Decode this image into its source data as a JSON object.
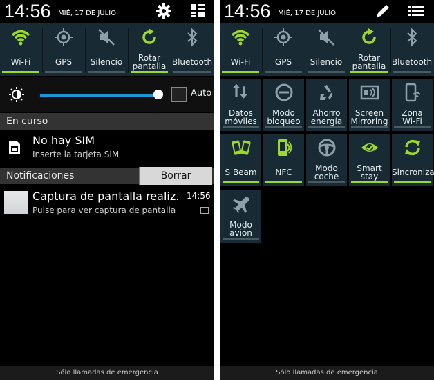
{
  "status": {
    "time": "14:56",
    "date": "MIÉ, 17 DE JULIO",
    "left_icons": [
      "gear-icon",
      "list-toggle-icon"
    ],
    "right_icons": [
      "edit-pencil-icon",
      "menu-list-icon"
    ]
  },
  "quick_settings": [
    {
      "label": "Wi-Fi",
      "icon": "wifi-icon",
      "active": true
    },
    {
      "label": "GPS",
      "icon": "gps-icon",
      "active": false
    },
    {
      "label": "Silencio",
      "icon": "mute-icon",
      "active": false
    },
    {
      "label_lines": [
        "Rotar",
        "pantalla"
      ],
      "icon": "rotate-icon",
      "active": true
    },
    {
      "label": "Bluetooth",
      "icon": "bluetooth-icon",
      "active": false
    }
  ],
  "brightness": {
    "auto_label": "Auto",
    "level": 0.95,
    "auto_checked": false
  },
  "en_curso": {
    "header": "En curso",
    "sim_title": "No hay SIM",
    "sim_text": "Inserte la tarjeta SIM"
  },
  "notificaciones": {
    "header": "Notificaciones",
    "clear_label": "Borrar",
    "item": {
      "title": "Captura de pantalla realiz..",
      "time": "14:56",
      "text": "Pulse para ver captura de pantalla"
    }
  },
  "grid_tiles": [
    {
      "label_lines": [
        "Datos",
        "móviles"
      ],
      "icon": "mobile-data-icon",
      "active": false
    },
    {
      "label_lines": [
        "Modo",
        "bloqueo"
      ],
      "icon": "block-mode-icon",
      "active": false
    },
    {
      "label_lines": [
        "Ahorro",
        "energía"
      ],
      "icon": "power-saving-icon",
      "active": false
    },
    {
      "label_lines": [
        "Screen",
        "Mirroring"
      ],
      "icon": "screen-mirroring-icon",
      "active": false
    },
    {
      "label_lines": [
        "Zona",
        "Wi-Fi"
      ],
      "icon": "hotspot-icon",
      "active": false
    },
    {
      "label": "S Beam",
      "icon": "s-beam-icon",
      "active": true
    },
    {
      "label": "NFC",
      "icon": "nfc-icon",
      "active": true
    },
    {
      "label_lines": [
        "Modo",
        "coche"
      ],
      "icon": "car-mode-icon",
      "active": false
    },
    {
      "label_lines": [
        "Smart",
        "stay"
      ],
      "icon": "smart-stay-icon",
      "active": true
    },
    {
      "label": "Sincronizar",
      "icon": "sync-icon",
      "active": true
    },
    {
      "label_lines": [
        "Modo",
        "avión"
      ],
      "icon": "airplane-icon",
      "active": false
    }
  ],
  "emergency": "Sólo llamadas de emergencia",
  "colors": {
    "active_green": "#9dd82b",
    "tile_bg": "#182a33",
    "slider_blue": "#1f93d6"
  }
}
